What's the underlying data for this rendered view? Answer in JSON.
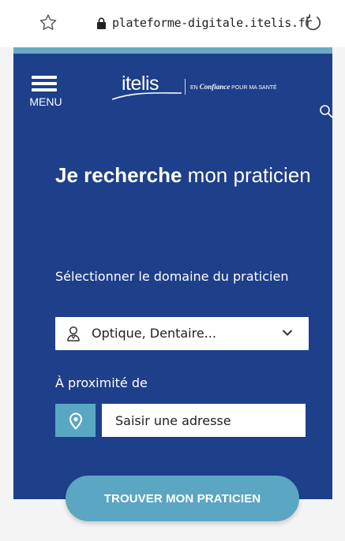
{
  "browser": {
    "url": "plateforme-digitale.itelis.fr",
    "icons": [
      "star-icon",
      "lock-icon",
      "reload-icon"
    ]
  },
  "header": {
    "menu_label": "MENU",
    "logo_text": "itelis",
    "logo_tagline_prefix": "EN",
    "logo_tagline_emphasis": "Confiance",
    "logo_tagline_suffix": "POUR MA SANTÉ",
    "icons": [
      "hamburger-icon",
      "search-icon"
    ]
  },
  "search": {
    "title_bold": "Je recherche",
    "title_rest": " mon praticien",
    "domain_label": "Sélectionner le domaine du praticien",
    "domain_value": "Optique, Dentaire...",
    "proximity_label": "À proximité de",
    "address_placeholder": "Saisir une adresse",
    "submit_label": "TROUVER MON PRATICIEN"
  },
  "colors": {
    "panel": "#1e3f8a",
    "accent": "#5ba6c2",
    "background": "#f4f4f4"
  }
}
